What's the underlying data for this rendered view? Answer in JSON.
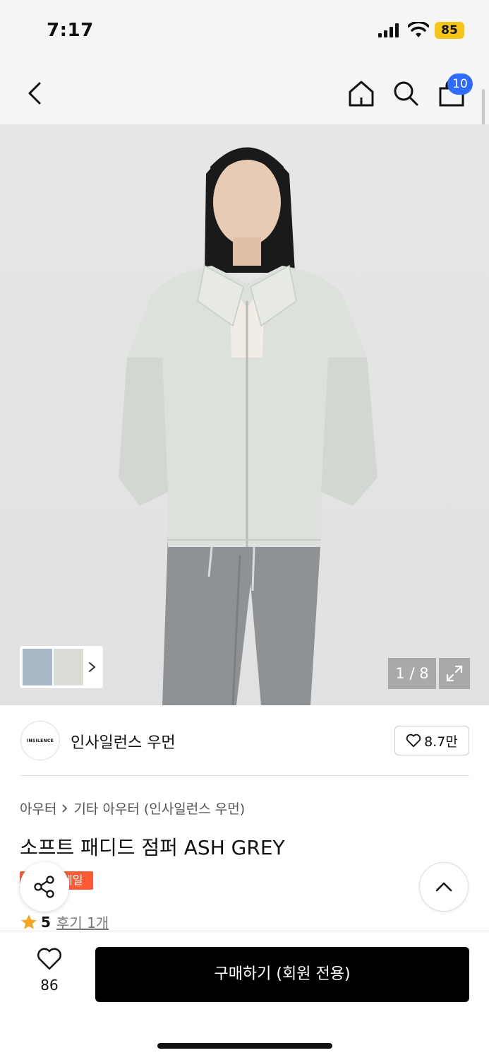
{
  "status_bar": {
    "time": "7:17",
    "battery": "85"
  },
  "nav": {
    "cart_count": "10"
  },
  "gallery": {
    "page_counter": "1 / 8"
  },
  "brand": {
    "logo_text": "INSILENCE",
    "name": "인사일런스 우먼",
    "likes": "8.7만"
  },
  "breadcrumb": {
    "category": "아우터",
    "subcategory": "기타 아우터 (인사일런스 우먼)"
  },
  "product": {
    "title": "소프트 패디드 점퍼 ASH GREY",
    "badge": "세일",
    "rating": "5",
    "reviews": "후기 1개"
  },
  "bottom": {
    "wish_count": "86",
    "buy_label": "구매하기 (회원 전용)"
  },
  "colors": {
    "sale": "#ff5a36",
    "badge_blue": "#2f6bff",
    "star": "#f5a623",
    "battery": "#f5c518"
  },
  "icons": [
    "back-icon",
    "home-icon",
    "search-icon",
    "shopping-bag-icon",
    "chevron-right-icon",
    "expand-icon",
    "heart-icon",
    "share-icon",
    "chevron-up-icon",
    "star-icon",
    "signal-icon",
    "wifi-icon"
  ]
}
